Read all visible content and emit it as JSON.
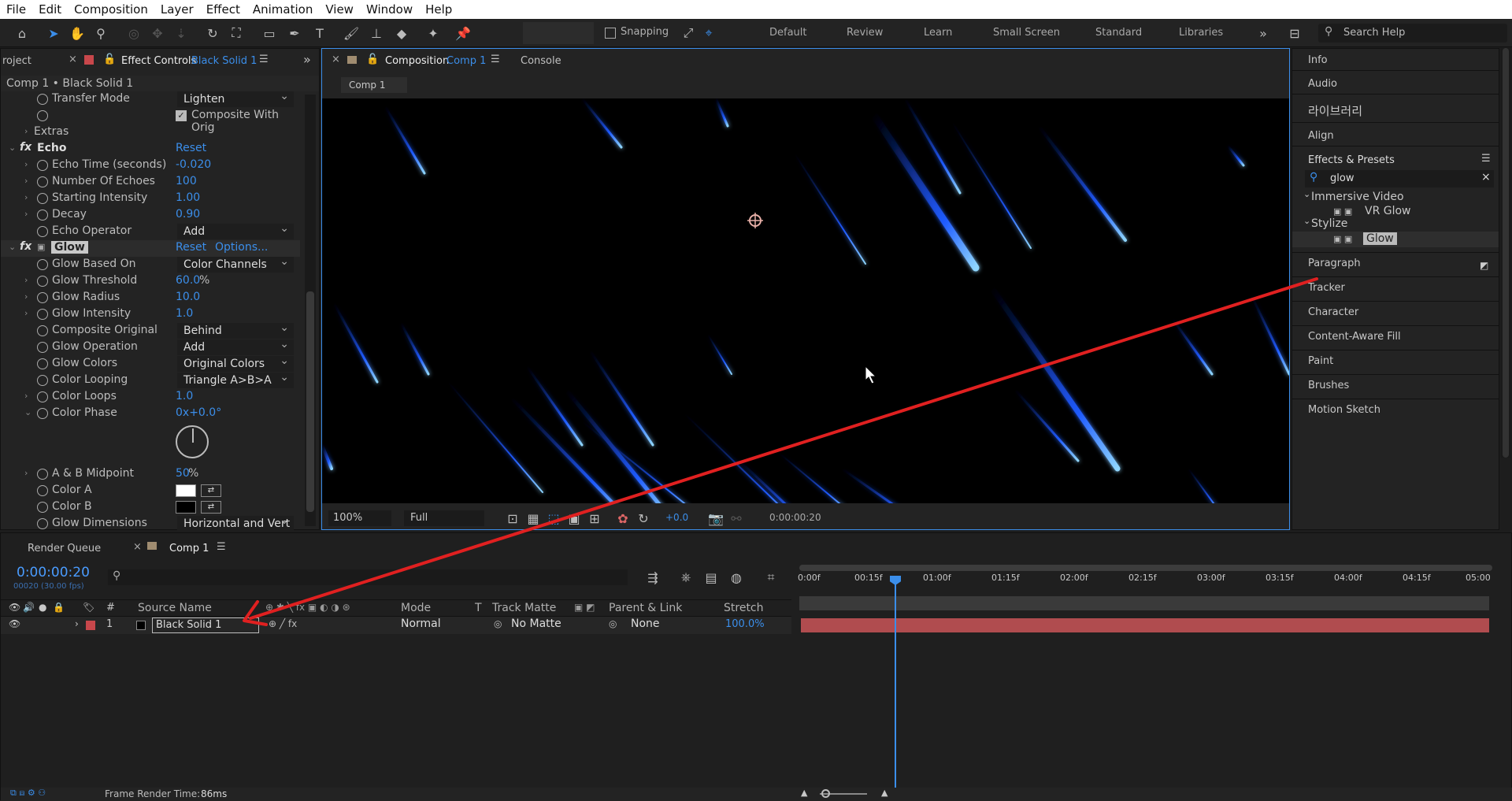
{
  "menu": [
    "File",
    "Edit",
    "Composition",
    "Layer",
    "Effect",
    "Animation",
    "View",
    "Window",
    "Help"
  ],
  "toolbar": {
    "snapping_label": "Snapping",
    "search_placeholder": "Search Help"
  },
  "workspaces": [
    "Default",
    "Review",
    "Learn",
    "Small Screen",
    "Standard",
    "Libraries"
  ],
  "left_panel": {
    "tab_project": "roject",
    "tab_effect_controls": "Effect Controls",
    "layer_name": "Black Solid 1",
    "breadcrumb": "Comp 1 • Black Solid 1",
    "transfer_mode_label": "Transfer Mode",
    "transfer_mode_value": "Lighten",
    "composite_with_orig": "Composite With Orig",
    "extras": "Extras",
    "echo": {
      "name": "Echo",
      "reset": "Reset",
      "props": [
        {
          "name": "Echo Time (seconds)",
          "value": "-0.020"
        },
        {
          "name": "Number Of Echoes",
          "value": "100"
        },
        {
          "name": "Starting Intensity",
          "value": "1.00"
        },
        {
          "name": "Decay",
          "value": "0.90"
        }
      ],
      "operator_label": "Echo Operator",
      "operator_value": "Add"
    },
    "glow": {
      "name": "Glow",
      "reset": "Reset",
      "options": "Options...",
      "based_on_label": "Glow Based On",
      "based_on_value": "Color Channels",
      "threshold_label": "Glow Threshold",
      "threshold_value": "60.0",
      "radius_label": "Glow Radius",
      "radius_value": "10.0",
      "intensity_label": "Glow Intensity",
      "intensity_value": "1.0",
      "composite_label": "Composite Original",
      "composite_value": "Behind",
      "operation_label": "Glow Operation",
      "operation_value": "Add",
      "colors_label": "Glow Colors",
      "colors_value": "Original Colors",
      "looping_label": "Color Looping",
      "looping_value": "Triangle A>B>A",
      "loops_label": "Color Loops",
      "loops_value": "1.0",
      "phase_label": "Color Phase",
      "phase_value": "0x+0.0°",
      "midpoint_label": "A & B Midpoint",
      "midpoint_value": "50",
      "color_a_label": "Color A",
      "color_a": "#ffffff",
      "color_b_label": "Color B",
      "color_b": "#000000",
      "dimensions_label": "Glow Dimensions",
      "dimensions_value": "Horizontal and Vert"
    }
  },
  "comp_panel": {
    "tab_composition": "Composition",
    "comp_name": "Comp 1",
    "tab_console": "Console",
    "flow_tab": "Comp 1",
    "zoom": "100%",
    "resolution": "Full",
    "exposure": "+0.0",
    "timecode": "0:00:00:20"
  },
  "right_panel": {
    "items": [
      "Info",
      "Audio",
      "라이브러리",
      "Align",
      "Effects & Presets"
    ],
    "search_value": "glow",
    "tree": [
      {
        "folder": "Immersive Video",
        "item": "VR Glow"
      },
      {
        "folder": "Stylize",
        "item": "Glow"
      }
    ],
    "lower_items": [
      "Paragraph",
      "Tracker",
      "Character",
      "Content-Aware Fill",
      "Paint",
      "Brushes",
      "Motion Sketch"
    ]
  },
  "timeline": {
    "tab_render_queue": "Render Queue",
    "tab_comp": "Comp 1",
    "timecode": "0:00:00:20",
    "fps": "00020 (30.00 fps)",
    "columns": {
      "source": "Source Name",
      "mode": "Mode",
      "t": "T",
      "track_matte": "Track Matte",
      "parent": "Parent & Link",
      "stretch": "Stretch"
    },
    "ruler": [
      "0:00f",
      "00:15f",
      "01:00f",
      "01:15f",
      "02:00f",
      "02:15f",
      "03:00f",
      "03:15f",
      "04:00f",
      "04:15f",
      "05:00"
    ],
    "layer": {
      "index": "1",
      "name": "Black Solid 1",
      "mode": "Normal",
      "matte": "No Matte",
      "parent": "None",
      "stretch": "100.0%"
    },
    "footer": "Frame Render Time:",
    "render_time": "86ms",
    "layer_bar_color": "#b04c4f"
  }
}
